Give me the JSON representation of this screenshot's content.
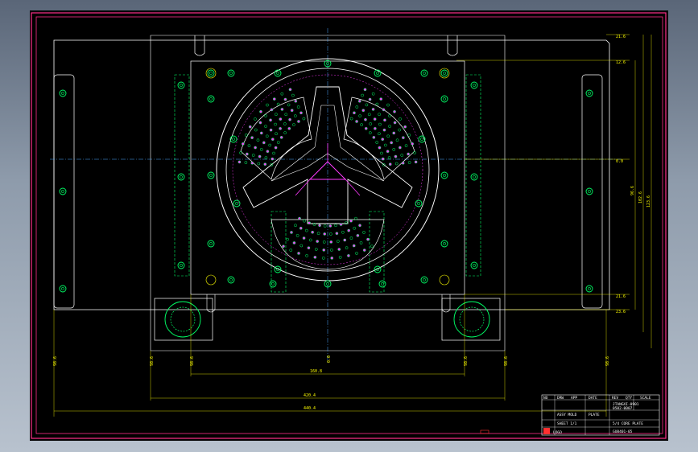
{
  "colors": {
    "background": "#000000",
    "border": "#ff2e8a",
    "outline": "#ffffff",
    "dimension": "#ffff00",
    "hole": "#00ff66",
    "centerline": "#4da6ff",
    "accent": "#ff3aff",
    "highlight": "#ff3030"
  },
  "dimensions": {
    "right": [
      "21.6",
      "12.6",
      "0.0",
      "21.6",
      "23.6"
    ],
    "right_vertical": [
      "96.6",
      "102.6",
      "123.6"
    ],
    "bottom_ticks": [
      "98.6",
      "98.6",
      "98.6",
      "98.6",
      "98.6",
      "98.6",
      "98.6"
    ],
    "bottom_rows": [
      "160.8",
      "420.4",
      "440.4"
    ],
    "center_vertical": "0.0"
  },
  "title_block": {
    "header_cells": [
      "NO",
      "DRW",
      "APP",
      "DATE",
      "REV",
      "QTY",
      "SCALE"
    ],
    "rows": [
      "JTANGXI-0901",
      "0502-0007",
      "ASSY MOLD",
      "PLATE"
    ],
    "drawing_no": "GU0401-05",
    "part_name": "5/4 CORE PLATE",
    "revision": "SHEET 1/1",
    "logo_text": "LOGO"
  }
}
